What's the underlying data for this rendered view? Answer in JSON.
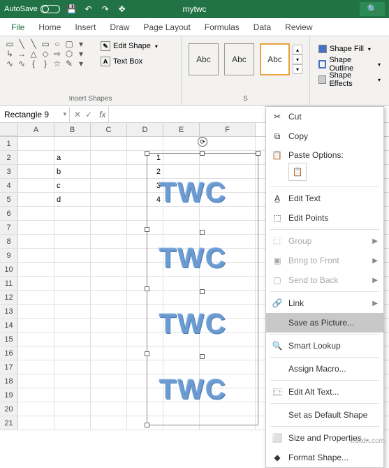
{
  "titlebar": {
    "autosave": "AutoSave",
    "doc": "mytwc"
  },
  "tabs": [
    "File",
    "Home",
    "Insert",
    "Draw",
    "Page Layout",
    "Formulas",
    "Data",
    "Review"
  ],
  "ribbon": {
    "insert_shapes_label": "Insert Shapes",
    "edit_shape": "Edit Shape",
    "text_box": "Text Box",
    "styles_abc": "Abc",
    "styles_group_label": "S",
    "shape_fill": "Shape Fill",
    "shape_outline": "Shape Outline",
    "shape_effects": "Shape Effects"
  },
  "name_box": "Rectangle 9",
  "columns": [
    "A",
    "B",
    "C",
    "D",
    "E",
    "F"
  ],
  "rows": [
    1,
    2,
    3,
    4,
    5,
    6,
    7,
    8,
    9,
    10,
    11,
    12,
    13,
    14,
    15,
    16,
    17,
    18,
    19,
    20,
    21
  ],
  "cells": {
    "b2": "a",
    "b3": "b",
    "b4": "c",
    "b5": "d",
    "d2": "1",
    "d3": "2",
    "d4": "3",
    "d5": "4"
  },
  "shape_text": "TWC",
  "context_menu": {
    "cut": "Cut",
    "copy": "Copy",
    "paste_options": "Paste Options:",
    "edit_text": "Edit Text",
    "edit_points": "Edit Points",
    "group": "Group",
    "bring_front": "Bring to Front",
    "send_back": "Send to Back",
    "link": "Link",
    "save_as_picture": "Save as Picture...",
    "smart_lookup": "Smart Lookup",
    "assign_macro": "Assign Macro...",
    "edit_alt_text": "Edit Alt Text...",
    "set_default": "Set as Default Shape",
    "size_props": "Size and Properties...",
    "format_shape": "Format Shape..."
  },
  "watermark": "wsxdn.com"
}
